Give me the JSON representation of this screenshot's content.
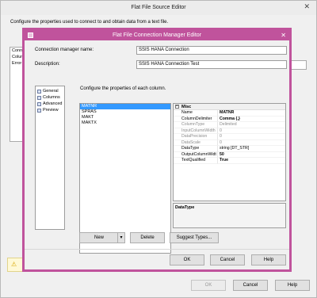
{
  "outer": {
    "title": "Flat File Source Editor",
    "description": "Configure the properties used to connect to and obtain data from a text file.",
    "left_items": [
      "Conne",
      "Colum",
      "Error"
    ],
    "buttons": {
      "ok": "OK",
      "cancel": "Cancel",
      "help": "Help"
    }
  },
  "inner": {
    "title": "Flat File Connection Manager Editor",
    "conn_name_label": "Connection manager name:",
    "conn_name_value": "SSIS HANA Connection",
    "desc_label": "Description:",
    "desc_value": "SSIS HANA Connection Test",
    "nav": [
      "General",
      "Columns",
      "Advanced",
      "Preview"
    ],
    "hint": "Configure the properties of each column.",
    "columns": [
      "MATNR",
      "SPRAS",
      "MAKT",
      "MAKTX"
    ],
    "props_section": "Misc",
    "props": [
      {
        "name": "Name",
        "value": "MATNR",
        "dim": false,
        "bold": true
      },
      {
        "name": "ColumnDelimiter",
        "value": "Comma {,}",
        "dim": false,
        "bold": true
      },
      {
        "name": "ColumnType",
        "value": "Delimited",
        "dim": true,
        "bold": false
      },
      {
        "name": "InputColumnWidth",
        "value": "0",
        "dim": true,
        "bold": false
      },
      {
        "name": "DataPrecision",
        "value": "0",
        "dim": true,
        "bold": false
      },
      {
        "name": "DataScale",
        "value": "0",
        "dim": true,
        "bold": false
      },
      {
        "name": "DataType",
        "value": "string [DT_STR]",
        "dim": false,
        "bold": false
      },
      {
        "name": "OutputColumnWidt",
        "value": "50",
        "dim": false,
        "bold": true
      },
      {
        "name": "TextQualified",
        "value": "True",
        "dim": false,
        "bold": true
      }
    ],
    "desc_panel": "DataType",
    "buttons": {
      "new": "New",
      "new_arrow": "▾",
      "delete": "Delete",
      "suggest": "Suggest Types...",
      "ok": "OK",
      "cancel": "Cancel",
      "help": "Help"
    }
  },
  "colors": {
    "accent": "#c0539c",
    "selection": "#3399ff"
  }
}
